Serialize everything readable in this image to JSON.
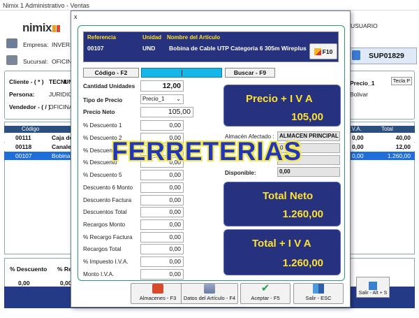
{
  "background_window": {
    "title": "Nimix 1 Administrativo - Ventas",
    "logo": "nimix",
    "usuario_label": "USUARIO",
    "empresa_label": "Empresa:",
    "empresa_value": "INVERSIO",
    "sucursal_label": "Sucursal:",
    "sucursal_value": "OFICINA",
    "document_number": "SUP01829",
    "cliente_label": "Cliente - ( * )",
    "cliente_value": "TECNI",
    "cliente_value2": "UN",
    "persona_label": "Persona:",
    "persona_value": "JURIDICA",
    "vendedor_label": "Vendedor - ( / )",
    "vendedor_value": "OFICINA",
    "precio_label": "Precio_1",
    "tecla_label": "Tecla P",
    "bolivar": "Bolivar",
    "grid_columns": [
      "Código",
      "",
      "I.V.A.",
      "Total"
    ],
    "grid_rows": [
      {
        "code": "00111",
        "desc": "Caja de P",
        "iva": "0,00",
        "total": "40,00",
        "selected": false
      },
      {
        "code": "00118",
        "desc": "Canaleta",
        "iva": "0,00",
        "total": "12,00",
        "selected": false
      },
      {
        "code": "00107",
        "desc": "Bobina d",
        "iva": "0,00",
        "total": "1.260,00",
        "selected": true
      }
    ],
    "bottom_labels": [
      "% Descuento",
      "% Recar"
    ],
    "bottom_values": [
      "0,00",
      "0,00"
    ],
    "salir_label": "Salir - Alt + S"
  },
  "modal": {
    "close_label": "x",
    "header": {
      "referencia_label": "Referencia",
      "unidad_label": "Unidad",
      "nombre_label": "Nombre del Artículo",
      "referencia": "00107",
      "unidad": "UND",
      "nombre": "Bobina de Cable UTP Categoria 6 305m Wireplus",
      "f10_label": "F10"
    },
    "codigo_button": "Código - F2",
    "buscar_button": "Buscar - F9",
    "cantidad_label": "Cantidad Unidades",
    "cantidad_value": "12,00",
    "tipo_precio_label": "Tipo de Precio",
    "tipo_precio_value": "Precio_1",
    "precio_neto_label": "Precio Neto",
    "precio_neto_value": "105,00",
    "rows": [
      {
        "label": "% Descuento 1",
        "value": "0,00"
      },
      {
        "label": "% Descuento 2",
        "value": "0,00"
      },
      {
        "label": "% Descuento",
        "value": "0,00"
      },
      {
        "label": "% Descuento",
        "value": "0,00"
      },
      {
        "label": "% Descuento 5",
        "value": "0,00"
      },
      {
        "label": "Descuento 6 Monto",
        "value": "0,00"
      },
      {
        "label": "Descuento Factura",
        "value": "0,00"
      },
      {
        "label": "Descuentos Total",
        "value": "0,00"
      },
      {
        "label": "Recargos Monto",
        "value": "0,00"
      },
      {
        "label": "% Recargo Factura",
        "value": "0,00"
      },
      {
        "label": "Recargos Total",
        "value": "0,00"
      },
      {
        "label": "% Impuesto I.V.A.",
        "value": "0,00"
      },
      {
        "label": "Monto I.V.A.",
        "value": "0,00"
      }
    ],
    "precio_iva_title": "Precio + I V A",
    "precio_iva_value": "105,00",
    "almacen_label": "Almacén Afectado :",
    "almacen_value": "ALMACEN PRINCIPAL",
    "extra_values": [
      "0",
      "0"
    ],
    "disponible_label": "Disponible:",
    "disponible_value": "0,00",
    "total_neto_title": "Total Neto",
    "total_neto_value": "1.260,00",
    "total_iva_title": "Total + I V A",
    "total_iva_value": "1.260,00",
    "footer_buttons": [
      {
        "label": "Almacenes - F3",
        "icon": "warehouse-icon"
      },
      {
        "label": "Datos del Artículo - F4",
        "icon": "article-data-icon"
      },
      {
        "label": "Aceptar - F5",
        "icon": "checkmark-icon"
      },
      {
        "label": "Salir - ESC",
        "icon": "exit-door-icon"
      }
    ]
  },
  "watermark": "FERRETERIAS",
  "colors": {
    "panel_blue": "#26327e",
    "accent_yellow": "#ffe033",
    "frame_green": "#2a9a6a",
    "input_cyan": "#16b6e8",
    "grid_selected": "#1e6fd9"
  }
}
